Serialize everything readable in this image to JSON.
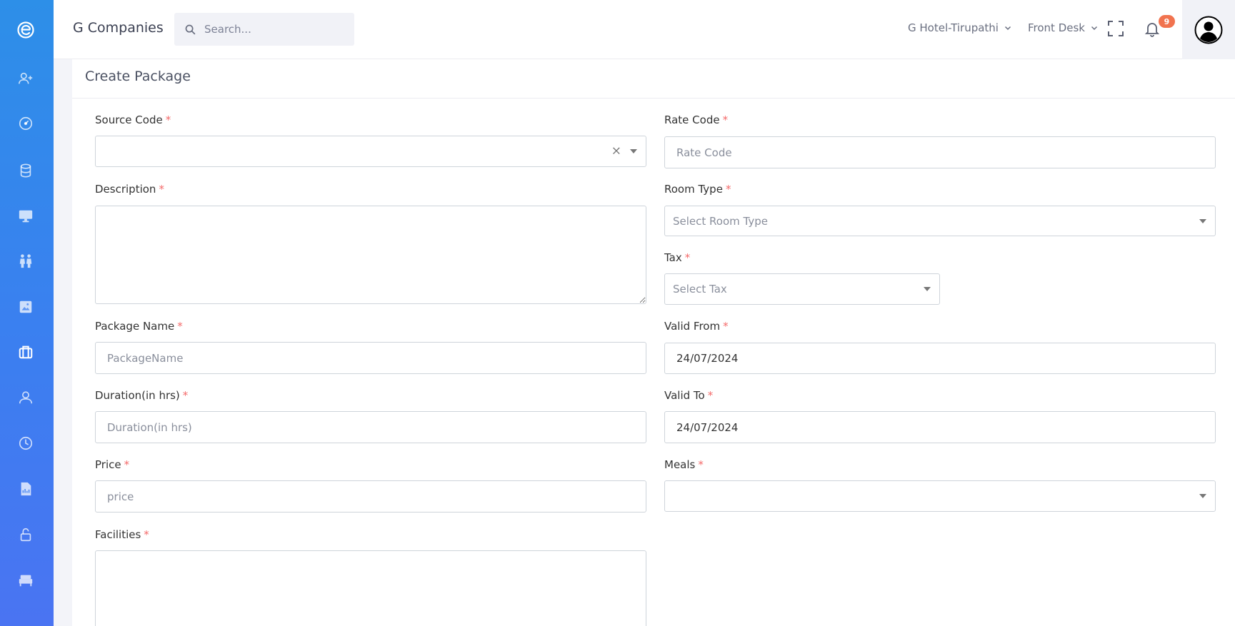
{
  "header": {
    "brand": "G Companies",
    "search_placeholder": "Search...",
    "hotel_select": "G Hotel-Tirupathi",
    "role_select": "Front Desk",
    "notification_count": "9"
  },
  "sidebar": {
    "items": [
      "add-user-icon",
      "dashboard-gauge-icon",
      "database-icon",
      "monitor-icon",
      "people-icon",
      "gallery-icon",
      "briefcase-icon",
      "user-icon",
      "clock-icon",
      "report-icon",
      "unlock-icon",
      "bed-icon"
    ]
  },
  "colors": {
    "sidebar_top": "#2d8fe8",
    "sidebar_bottom": "#4a74f2",
    "required": "#f46a6a",
    "badge": "#f1734f"
  },
  "form": {
    "title": "Create Package",
    "source_code": {
      "label": "Source Code",
      "value": "",
      "clear": "×"
    },
    "rate_code": {
      "label": "Rate Code",
      "placeholder": "Rate Code"
    },
    "description": {
      "label": "Description",
      "value": ""
    },
    "room_type": {
      "label": "Room Type",
      "placeholder": "Select Room Type"
    },
    "tax": {
      "label": "Tax",
      "placeholder": "Select Tax"
    },
    "package_name": {
      "label": "Package Name",
      "placeholder": "PackageName"
    },
    "valid_from": {
      "label": "Valid From",
      "value": "24/07/2024"
    },
    "duration": {
      "label": "Duration(in hrs)",
      "placeholder": "Duration(in hrs)"
    },
    "valid_to": {
      "label": "Valid To",
      "value": "24/07/2024"
    },
    "price": {
      "label": "Price",
      "placeholder": "price"
    },
    "meals": {
      "label": "Meals",
      "value": ""
    },
    "facilities": {
      "label": "Facilities",
      "value": ""
    },
    "required_mark": "*"
  }
}
